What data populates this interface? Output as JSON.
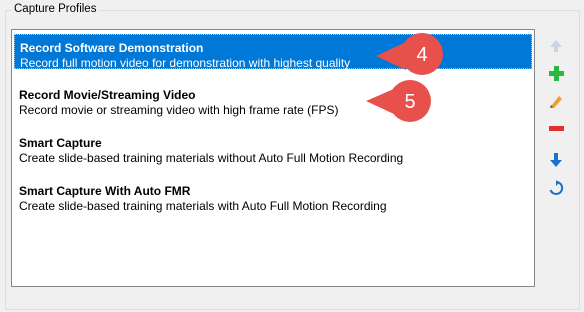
{
  "group": {
    "title": "Capture Profiles"
  },
  "profiles": [
    {
      "title": "Record Software Demonstration",
      "desc": "Record full motion video for demonstration with highest quality",
      "selected": true
    },
    {
      "title": "Record Movie/Streaming Video",
      "desc": "Record movie or streaming video with high frame rate (FPS)",
      "selected": false
    },
    {
      "title": "Smart Capture",
      "desc": "Create slide-based training materials without Auto Full Motion Recording",
      "selected": false
    },
    {
      "title": "Smart Capture With Auto FMR",
      "desc": "Create slide-based training materials with Auto Full Motion Recording",
      "selected": false
    }
  ],
  "callouts": [
    {
      "label": "4",
      "color": "#e8504b"
    },
    {
      "label": "5",
      "color": "#e8504b"
    }
  ],
  "toolbar": [
    {
      "icon": "arrow-up-icon",
      "enabled": false
    },
    {
      "icon": "plus-icon",
      "enabled": true,
      "color": "#2db83d"
    },
    {
      "icon": "pencil-icon",
      "enabled": true,
      "color": "#f0a030"
    },
    {
      "icon": "minus-icon",
      "enabled": true,
      "color": "#e03030"
    },
    {
      "icon": "arrow-down-icon",
      "enabled": true,
      "color": "#1a73c8"
    },
    {
      "icon": "refresh-icon",
      "enabled": true,
      "color": "#1a73c8"
    }
  ],
  "colors": {
    "selection": "#0078d7",
    "callout": "#e8504b"
  }
}
